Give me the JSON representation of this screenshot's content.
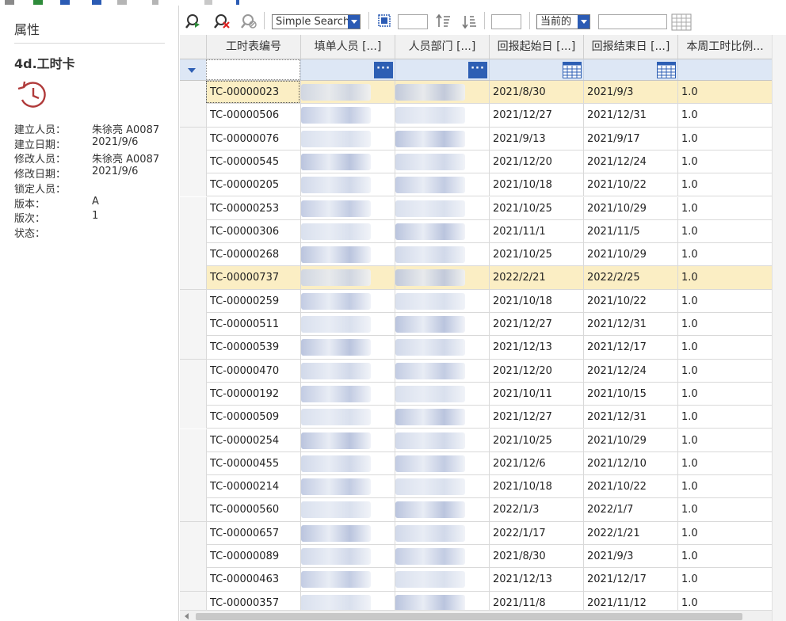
{
  "properties": {
    "title": "属性",
    "doc_name": "4d.工时卡",
    "fields": [
      {
        "key": "建立人员：",
        "value": "朱徐亮 A0087"
      },
      {
        "key": "建立日期：",
        "value": "2021/9/6"
      },
      {
        "key": "修改人员：",
        "value": "朱徐亮 A0087"
      },
      {
        "key": "修改日期：",
        "value": "2021/9/6"
      },
      {
        "key": "锁定人员：",
        "value": ""
      },
      {
        "key": "版本：",
        "value": "A"
      },
      {
        "key": "版次：",
        "value": "1"
      },
      {
        "key": "状态：",
        "value": ""
      }
    ]
  },
  "toolbar": {
    "search_mode": "Simple Search",
    "revision_filter": "当前的",
    "icons": [
      "search-go-icon",
      "clear-search-icon",
      "search-cancel-icon",
      "select-all-icon",
      "sort-ascending-icon",
      "sort-descending-icon",
      "table-icon"
    ]
  },
  "grid": {
    "columns": [
      "工时表编号",
      "填单人员 [...]",
      "人员部门 [...]",
      "回报起始日 [...]",
      "回报结束日 [...]",
      "本周工时比例..."
    ],
    "rows": [
      {
        "id": "TC-00000023",
        "start": "2021/8/30",
        "end": "2021/9/3",
        "ratio": "1.0",
        "highlight": true,
        "selected": true
      },
      {
        "id": "TC-00000506",
        "start": "2021/12/27",
        "end": "2021/12/31",
        "ratio": "1.0"
      },
      {
        "id": "TC-00000076",
        "start": "2021/9/13",
        "end": "2021/9/17",
        "ratio": "1.0"
      },
      {
        "id": "TC-00000545",
        "start": "2021/12/20",
        "end": "2021/12/24",
        "ratio": "1.0"
      },
      {
        "id": "TC-00000205",
        "start": "2021/10/18",
        "end": "2021/10/22",
        "ratio": "1.0"
      },
      {
        "id": "TC-00000253",
        "start": "2021/10/25",
        "end": "2021/10/29",
        "ratio": "1.0"
      },
      {
        "id": "TC-00000306",
        "start": "2021/11/1",
        "end": "2021/11/5",
        "ratio": "1.0"
      },
      {
        "id": "TC-00000268",
        "start": "2021/10/25",
        "end": "2021/10/29",
        "ratio": "1.0"
      },
      {
        "id": "TC-00000737",
        "start": "2022/2/21",
        "end": "2022/2/25",
        "ratio": "1.0",
        "highlight": true
      },
      {
        "id": "TC-00000259",
        "start": "2021/10/18",
        "end": "2021/10/22",
        "ratio": "1.0"
      },
      {
        "id": "TC-00000511",
        "start": "2021/12/27",
        "end": "2021/12/31",
        "ratio": "1.0"
      },
      {
        "id": "TC-00000539",
        "start": "2021/12/13",
        "end": "2021/12/17",
        "ratio": "1.0"
      },
      {
        "id": "TC-00000470",
        "start": "2021/12/20",
        "end": "2021/12/24",
        "ratio": "1.0"
      },
      {
        "id": "TC-00000192",
        "start": "2021/10/11",
        "end": "2021/10/15",
        "ratio": "1.0"
      },
      {
        "id": "TC-00000509",
        "start": "2021/12/27",
        "end": "2021/12/31",
        "ratio": "1.0"
      },
      {
        "id": "TC-00000254",
        "start": "2021/10/25",
        "end": "2021/10/29",
        "ratio": "1.0"
      },
      {
        "id": "TC-00000455",
        "start": "2021/12/6",
        "end": "2021/12/10",
        "ratio": "1.0"
      },
      {
        "id": "TC-00000214",
        "start": "2021/10/18",
        "end": "2021/10/22",
        "ratio": "1.0"
      },
      {
        "id": "TC-00000560",
        "start": "2022/1/3",
        "end": "2022/1/7",
        "ratio": "1.0"
      },
      {
        "id": "TC-00000657",
        "start": "2022/1/17",
        "end": "2022/1/21",
        "ratio": "1.0"
      },
      {
        "id": "TC-00000089",
        "start": "2021/8/30",
        "end": "2021/9/3",
        "ratio": "1.0"
      },
      {
        "id": "TC-00000463",
        "start": "2021/12/13",
        "end": "2021/12/17",
        "ratio": "1.0"
      },
      {
        "id": "TC-00000357",
        "start": "2021/11/8",
        "end": "2021/11/12",
        "ratio": "1.0"
      }
    ]
  },
  "colors": {
    "accent": "#2d5fb4",
    "highlight_row": "#fbeec4",
    "filter_row": "#dde7f5",
    "clock_icon": "#b03a3a"
  }
}
